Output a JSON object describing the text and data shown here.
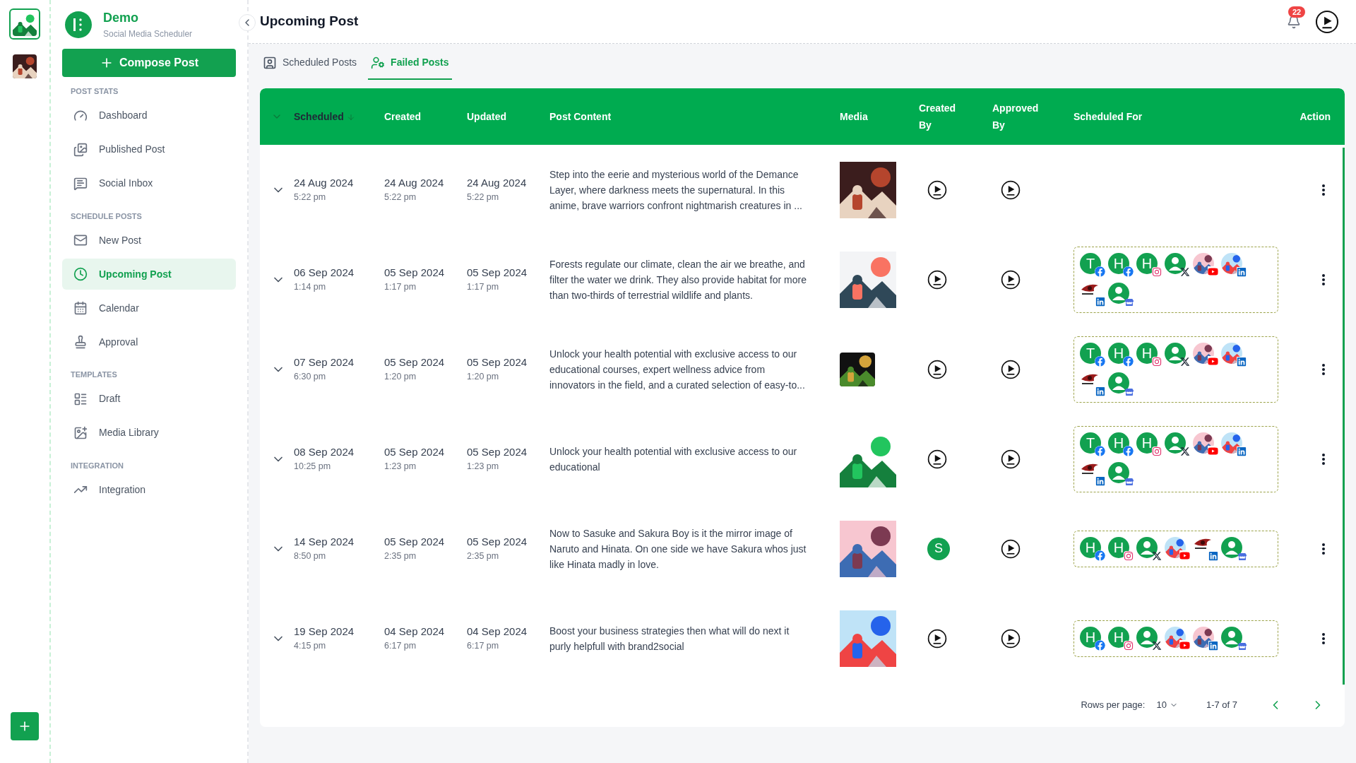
{
  "rail": {
    "workspaces": [
      {
        "selected": true
      },
      {
        "selected": false
      }
    ]
  },
  "brand": {
    "title": "Demo",
    "subtitle": "Social Media Scheduler"
  },
  "compose_button": "Compose Post",
  "sidebar": {
    "sections": [
      {
        "heading": "POST STATS",
        "items": [
          {
            "label": "Dashboard",
            "selected": false
          },
          {
            "label": "Published Post",
            "selected": false
          },
          {
            "label": "Social Inbox",
            "selected": false
          }
        ]
      },
      {
        "heading": "SCHEDULE POSTS",
        "items": [
          {
            "label": "New Post",
            "selected": false
          },
          {
            "label": "Upcoming Post",
            "selected": true
          },
          {
            "label": "Calendar",
            "selected": false
          },
          {
            "label": "Approval",
            "selected": false
          }
        ]
      },
      {
        "heading": "TEMPLATES",
        "items": [
          {
            "label": "Draft",
            "selected": false
          },
          {
            "label": "Media Library",
            "selected": false
          }
        ]
      },
      {
        "heading": "INTEGRATION",
        "items": [
          {
            "label": "Integration",
            "selected": false
          }
        ]
      }
    ]
  },
  "page_title": "Upcoming Post",
  "notifications": {
    "count": "22"
  },
  "tabs": [
    {
      "label": "Scheduled Posts",
      "selected": false
    },
    {
      "label": "Failed Posts",
      "selected": true
    }
  ],
  "table": {
    "columns": [
      {
        "label": "Scheduled",
        "sorted": true
      },
      {
        "label": "Created",
        "sorted": false
      },
      {
        "label": "Updated",
        "sorted": false
      },
      {
        "label": "Post Content",
        "sorted": false
      },
      {
        "label": "Media",
        "sorted": false
      },
      {
        "label": "Created By",
        "sorted": false
      },
      {
        "label": "Approved By",
        "sorted": false
      },
      {
        "label": "Scheduled For",
        "sorted": false
      },
      {
        "label": "Action",
        "sorted": false
      }
    ],
    "rows": [
      {
        "scheduled": {
          "date": "24 Aug 2024",
          "time": "5:22 pm"
        },
        "created": {
          "date": "24 Aug 2024",
          "time": "5:22 pm"
        },
        "updated": {
          "date": "24 Aug 2024",
          "time": "5:22 pm"
        },
        "content": "Step into the eerie and mysterious world of the Demance Layer, where darkness meets the supernatural. In this anime, brave warriors confront nightmarish creatures in ...",
        "creator": {
          "kind": "demo"
        },
        "approver": {
          "kind": "demo"
        },
        "accounts": []
      },
      {
        "scheduled": {
          "date": "06 Sep 2024",
          "time": "1:14 pm"
        },
        "created": {
          "date": "05 Sep 2024",
          "time": "1:17 pm"
        },
        "updated": {
          "date": "05 Sep 2024",
          "time": "1:17 pm"
        },
        "content": "Forests regulate our climate, clean the air we breathe, and filter the water we drink. They also provide habitat for more than two-thirds of terrestrial wildlife and plants.",
        "creator": {
          "kind": "demo"
        },
        "approver": {
          "kind": "demo"
        },
        "accounts": [
          {
            "kind": "letter",
            "letter": "T",
            "badge": {
              "kind": "facebook"
            }
          },
          {
            "kind": "letter",
            "letter": "H",
            "badge": {
              "kind": "facebook"
            }
          },
          {
            "kind": "letter",
            "letter": "H",
            "badge": {
              "kind": "instagram"
            }
          },
          {
            "kind": "person",
            "badge": {
              "kind": "x"
            }
          },
          {
            "kind": "picture",
            "badge": {
              "kind": "youtube"
            }
          },
          {
            "kind": "picture",
            "badge": {
              "kind": "linkedin"
            }
          },
          {
            "kind": "logo",
            "badge": {
              "kind": "linkedin"
            }
          },
          {
            "kind": "person",
            "badge": {
              "kind": "business"
            }
          }
        ]
      },
      {
        "scheduled": {
          "date": "07 Sep 2024",
          "time": "6:30 pm"
        },
        "created": {
          "date": "05 Sep 2024",
          "time": "1:20 pm"
        },
        "updated": {
          "date": "05 Sep 2024",
          "time": "1:20 pm"
        },
        "content": "Unlock your health potential with exclusive access to our educational courses, expert wellness advice from innovators in the field, and a curated selection of easy-to...",
        "creator": {
          "kind": "demo"
        },
        "approver": {
          "kind": "demo"
        },
        "accounts": [
          {
            "kind": "letter",
            "letter": "T",
            "badge": {
              "kind": "facebook"
            }
          },
          {
            "kind": "letter",
            "letter": "H",
            "badge": {
              "kind": "facebook"
            }
          },
          {
            "kind": "letter",
            "letter": "H",
            "badge": {
              "kind": "instagram"
            }
          },
          {
            "kind": "person",
            "badge": {
              "kind": "x"
            }
          },
          {
            "kind": "picture",
            "badge": {
              "kind": "youtube"
            }
          },
          {
            "kind": "picture",
            "badge": {
              "kind": "linkedin"
            }
          },
          {
            "kind": "logo",
            "badge": {
              "kind": "linkedin"
            }
          },
          {
            "kind": "person",
            "badge": {
              "kind": "business"
            }
          }
        ]
      },
      {
        "scheduled": {
          "date": "08 Sep 2024",
          "time": "10:25 pm"
        },
        "created": {
          "date": "05 Sep 2024",
          "time": "1:23 pm"
        },
        "updated": {
          "date": "05 Sep 2024",
          "time": "1:23 pm"
        },
        "content": "Unlock your health potential with exclusive access to our educational",
        "creator": {
          "kind": "demo"
        },
        "approver": {
          "kind": "demo"
        },
        "accounts": [
          {
            "kind": "letter",
            "letter": "T",
            "badge": {
              "kind": "facebook"
            }
          },
          {
            "kind": "letter",
            "letter": "H",
            "badge": {
              "kind": "facebook"
            }
          },
          {
            "kind": "letter",
            "letter": "H",
            "badge": {
              "kind": "instagram"
            }
          },
          {
            "kind": "person",
            "badge": {
              "kind": "x"
            }
          },
          {
            "kind": "picture",
            "badge": {
              "kind": "youtube"
            }
          },
          {
            "kind": "picture",
            "badge": {
              "kind": "linkedin"
            }
          },
          {
            "kind": "logo",
            "badge": {
              "kind": "linkedin"
            }
          },
          {
            "kind": "person",
            "badge": {
              "kind": "business"
            }
          }
        ]
      },
      {
        "scheduled": {
          "date": "14 Sep 2024",
          "time": "8:50 pm"
        },
        "created": {
          "date": "05 Sep 2024",
          "time": "2:35 pm"
        },
        "updated": {
          "date": "05 Sep 2024",
          "time": "2:35 pm"
        },
        "content": "Now to Sasuke and Sakura Boy is it the mirror image of Naruto and Hinata. On one side we have Sakura whos just like Hinata madly in love.",
        "creator": {
          "kind": "letter",
          "letter": "S"
        },
        "approver": {
          "kind": "demo"
        },
        "accounts": [
          {
            "kind": "letter",
            "letter": "H",
            "badge": {
              "kind": "facebook"
            }
          },
          {
            "kind": "letter",
            "letter": "H",
            "badge": {
              "kind": "instagram"
            }
          },
          {
            "kind": "person",
            "badge": {
              "kind": "x"
            }
          },
          {
            "kind": "picture",
            "badge": {
              "kind": "youtube"
            }
          },
          {
            "kind": "logo",
            "badge": {
              "kind": "linkedin"
            }
          },
          {
            "kind": "person",
            "badge": {
              "kind": "business"
            }
          }
        ]
      },
      {
        "scheduled": {
          "date": "19 Sep 2024",
          "time": "4:15 pm"
        },
        "created": {
          "date": "04 Sep 2024",
          "time": "6:17 pm"
        },
        "updated": {
          "date": "04 Sep 2024",
          "time": "6:17 pm"
        },
        "content": "Boost your business strategies then what will do next it purly helpfull with brand2social",
        "creator": {
          "kind": "demo"
        },
        "approver": {
          "kind": "demo"
        },
        "accounts": [
          {
            "kind": "letter",
            "letter": "H",
            "badge": {
              "kind": "facebook"
            }
          },
          {
            "kind": "letter",
            "letter": "H",
            "badge": {
              "kind": "instagram"
            }
          },
          {
            "kind": "person",
            "badge": {
              "kind": "x"
            }
          },
          {
            "kind": "picture",
            "badge": {
              "kind": "youtube"
            }
          },
          {
            "kind": "picture",
            "badge": {
              "kind": "linkedin"
            }
          },
          {
            "kind": "person",
            "badge": {
              "kind": "business"
            }
          }
        ]
      }
    ]
  },
  "pagination": {
    "label": "Rows per page:",
    "value": "10",
    "range": "1-7 of 7"
  }
}
